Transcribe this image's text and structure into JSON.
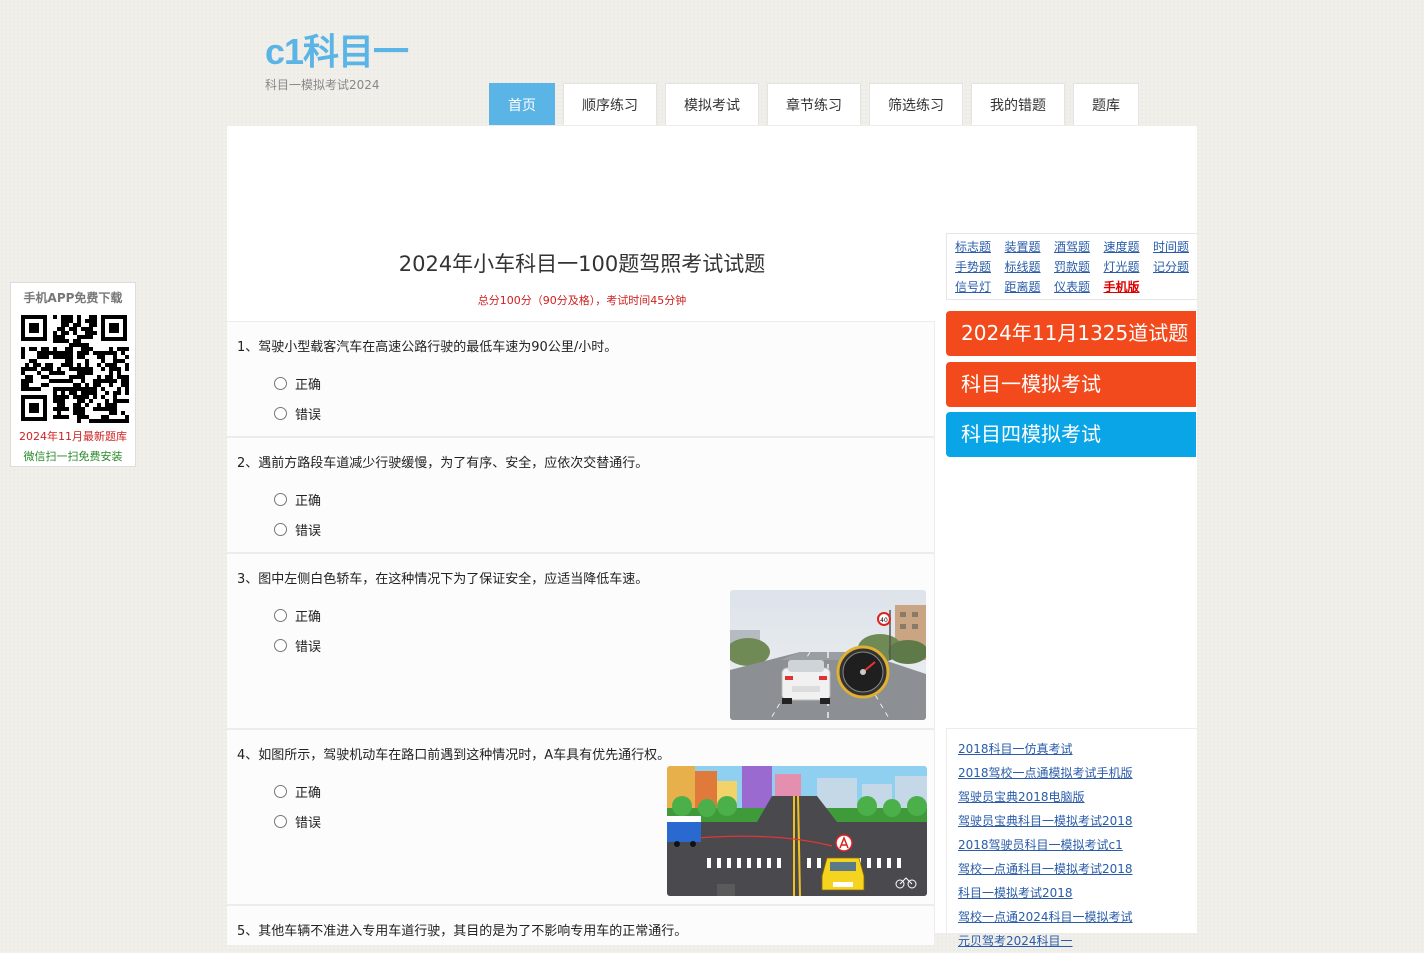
{
  "logo": {
    "title": "c1科目一",
    "subtitle": "科目一模拟考试2024"
  },
  "nav": [
    "首页",
    "顺序练习",
    "模拟考试",
    "章节练习",
    "筛选练习",
    "我的错题",
    "题库"
  ],
  "exam": {
    "title": "2024年小车科目一100题驾照考试试题",
    "subtitle": "总分100分（90分及格），考试时间45分钟"
  },
  "options": {
    "a": "正确",
    "b": "错误"
  },
  "questions": [
    {
      "text": "1、驾驶小型载客汽车在高速公路行驶的最低车速为90公里/小时。"
    },
    {
      "text": "2、遇前方路段车道减少行驶缓慢，为了有序、安全，应依次交替通行。"
    },
    {
      "text": "3、图中左侧白色轿车，在这种情况下为了保证安全，应适当降低车速。"
    },
    {
      "text": "4、如图所示，驾驶机动车在路口前遇到这种情况时，A车具有优先通行权。"
    },
    {
      "text": "5、其他车辆不准进入专用车道行驶，其目的是为了不影响专用车的正常通行。"
    }
  ],
  "categories": [
    "标志题",
    "装置题",
    "酒驾题",
    "速度题",
    "时间题",
    "手势题",
    "标线题",
    "罚款题",
    "灯光题",
    "记分题",
    "信号灯",
    "距离题",
    "仪表题",
    "手机版"
  ],
  "banners": [
    {
      "text": "2024年11月1325道试题",
      "color": "#f24a1c"
    },
    {
      "text": "科目一模拟考试",
      "color": "#f24a1c"
    },
    {
      "text": "科目四模拟考试",
      "color": "#0aa5e6"
    }
  ],
  "links": [
    "2018科目一仿真考试",
    "2018驾校一点通模拟考试手机版",
    "驾驶员宝典2018电脑版",
    "驾驶员宝典科目一模拟考试2018",
    "2018驾驶员科目一模拟考试c1",
    "驾校一点通科目一模拟考试2018",
    "科目一模拟考试2018",
    "驾校一点通2024科目一模拟考试",
    "元贝驾考2024科目一"
  ],
  "qr": {
    "title": "手机APP免费下载",
    "line1": "2024年11月最新题库",
    "line2": "微信扫一扫免费安装"
  },
  "speed_sign": "40"
}
